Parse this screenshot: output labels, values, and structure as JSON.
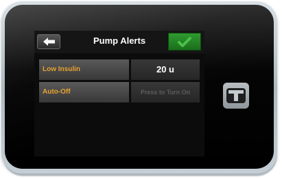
{
  "screen": {
    "title": "Pump Alerts",
    "back_icon": "left-arrow-icon",
    "confirm_icon": "checkmark-icon",
    "rows": [
      {
        "label": "Low Insulin",
        "value": "20 u"
      },
      {
        "label": "Auto-Off",
        "value": "Press to Turn On"
      }
    ]
  },
  "device": {
    "logo_icon": "t-logo-icon"
  },
  "colors": {
    "label_accent": "#e8a232",
    "confirm_green": "#2f9a2f",
    "value_disabled": "#5c5c5c"
  }
}
